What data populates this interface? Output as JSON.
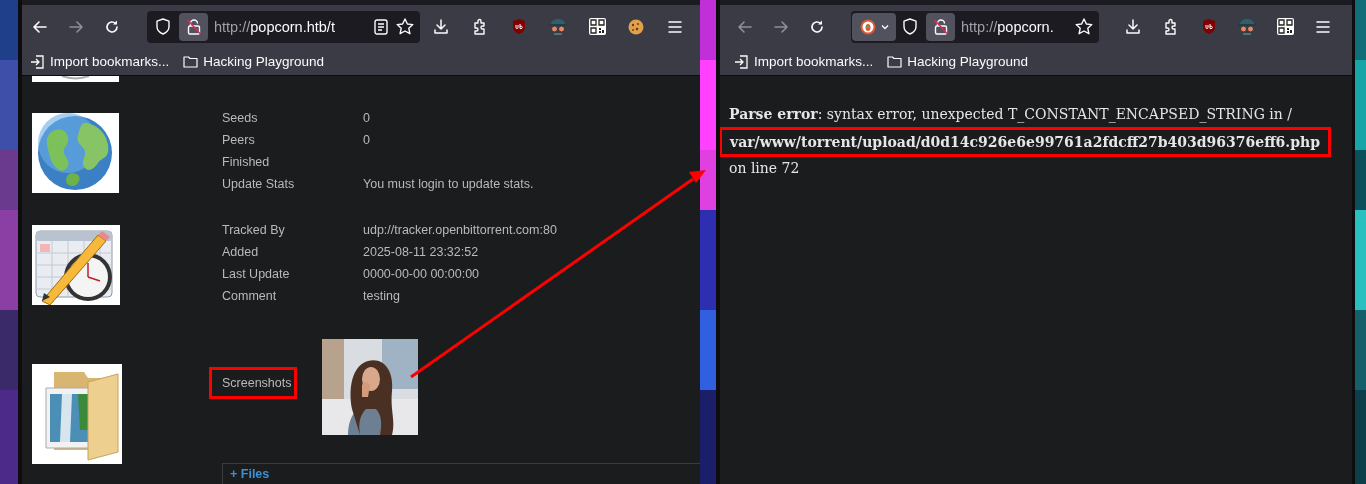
{
  "windows": [
    {
      "toolbar": {
        "nav": [
          {
            "kind": "back",
            "disabled": false
          },
          {
            "kind": "forward",
            "disabled": true
          },
          {
            "kind": "reload",
            "disabled": false
          }
        ],
        "url_bar": {
          "left": [
            {
              "kind": "shield"
            },
            {
              "kind": "lock"
            }
          ],
          "url_scheme": "http://",
          "url_rest": "popcorn.htb/t",
          "right": [
            {
              "kind": "reader"
            },
            {
              "kind": "star"
            }
          ]
        },
        "tools": [
          {
            "kind": "download"
          },
          {
            "kind": "extensions"
          },
          {
            "kind": "ublock"
          },
          {
            "kind": "spy"
          },
          {
            "kind": "qr"
          },
          {
            "kind": "cookie"
          },
          {
            "kind": "menu"
          }
        ]
      },
      "bookmarks": [
        {
          "kind": "import",
          "label": "Import bookmarks..."
        },
        {
          "kind": "folder",
          "label": "Hacking Playground"
        }
      ],
      "page": {
        "kind": "details",
        "groups": [
          {
            "kind": "disc"
          },
          {
            "kind": "globe",
            "rows": [
              {
                "label": "Seeds",
                "value": "0"
              },
              {
                "label": "Peers",
                "value": "0"
              },
              {
                "label": "Finished"
              },
              {
                "label": "Update Stats",
                "value": "You must login to update stats."
              }
            ]
          },
          {
            "kind": "calendar",
            "rows": [
              {
                "label": "Tracked By",
                "value": "udp://tracker.openbittorrent.com:80"
              },
              {
                "label": "Added",
                "value": "2025-08-11 23:32:52"
              },
              {
                "label": "Last Update",
                "value": "0000-00-00 00:00:00"
              },
              {
                "label": "Comment",
                "value": "testing"
              }
            ]
          }
        ],
        "screenshots": {
          "label": "Screenshots",
          "highlighted": true
        },
        "files": {
          "label": "+ Files"
        }
      }
    },
    {
      "toolbar": {
        "nav": [
          {
            "kind": "back",
            "disabled": true
          },
          {
            "kind": "forward",
            "disabled": true
          },
          {
            "kind": "reload",
            "disabled": false
          }
        ],
        "url_bar": {
          "left": [
            {
              "kind": "engine"
            },
            {
              "kind": "shield"
            },
            {
              "kind": "lock"
            }
          ],
          "url_scheme": "http://",
          "url_rest": "popcorn.",
          "right": [
            {
              "kind": "star"
            }
          ]
        },
        "tools": [
          {
            "kind": "download"
          },
          {
            "kind": "extensions"
          },
          {
            "kind": "ublock"
          },
          {
            "kind": "spy"
          },
          {
            "kind": "qr"
          },
          {
            "kind": "menu"
          }
        ]
      },
      "bookmarks": [
        {
          "kind": "import",
          "label": "Import bookmarks..."
        },
        {
          "kind": "folder",
          "label": "Hacking Playground"
        }
      ],
      "page": {
        "kind": "error",
        "heading": "Parse error",
        "message": ": syntax error, unexpected T_CONSTANT_ENCAPSED_STRING in /",
        "path": "var/www/torrent/upload/d0d14c926e6e99761a2fdcff27b403d96376eff6.php",
        "path_highlighted": true,
        "tail": "on line 72"
      }
    }
  ],
  "annotation_arrow": true
}
